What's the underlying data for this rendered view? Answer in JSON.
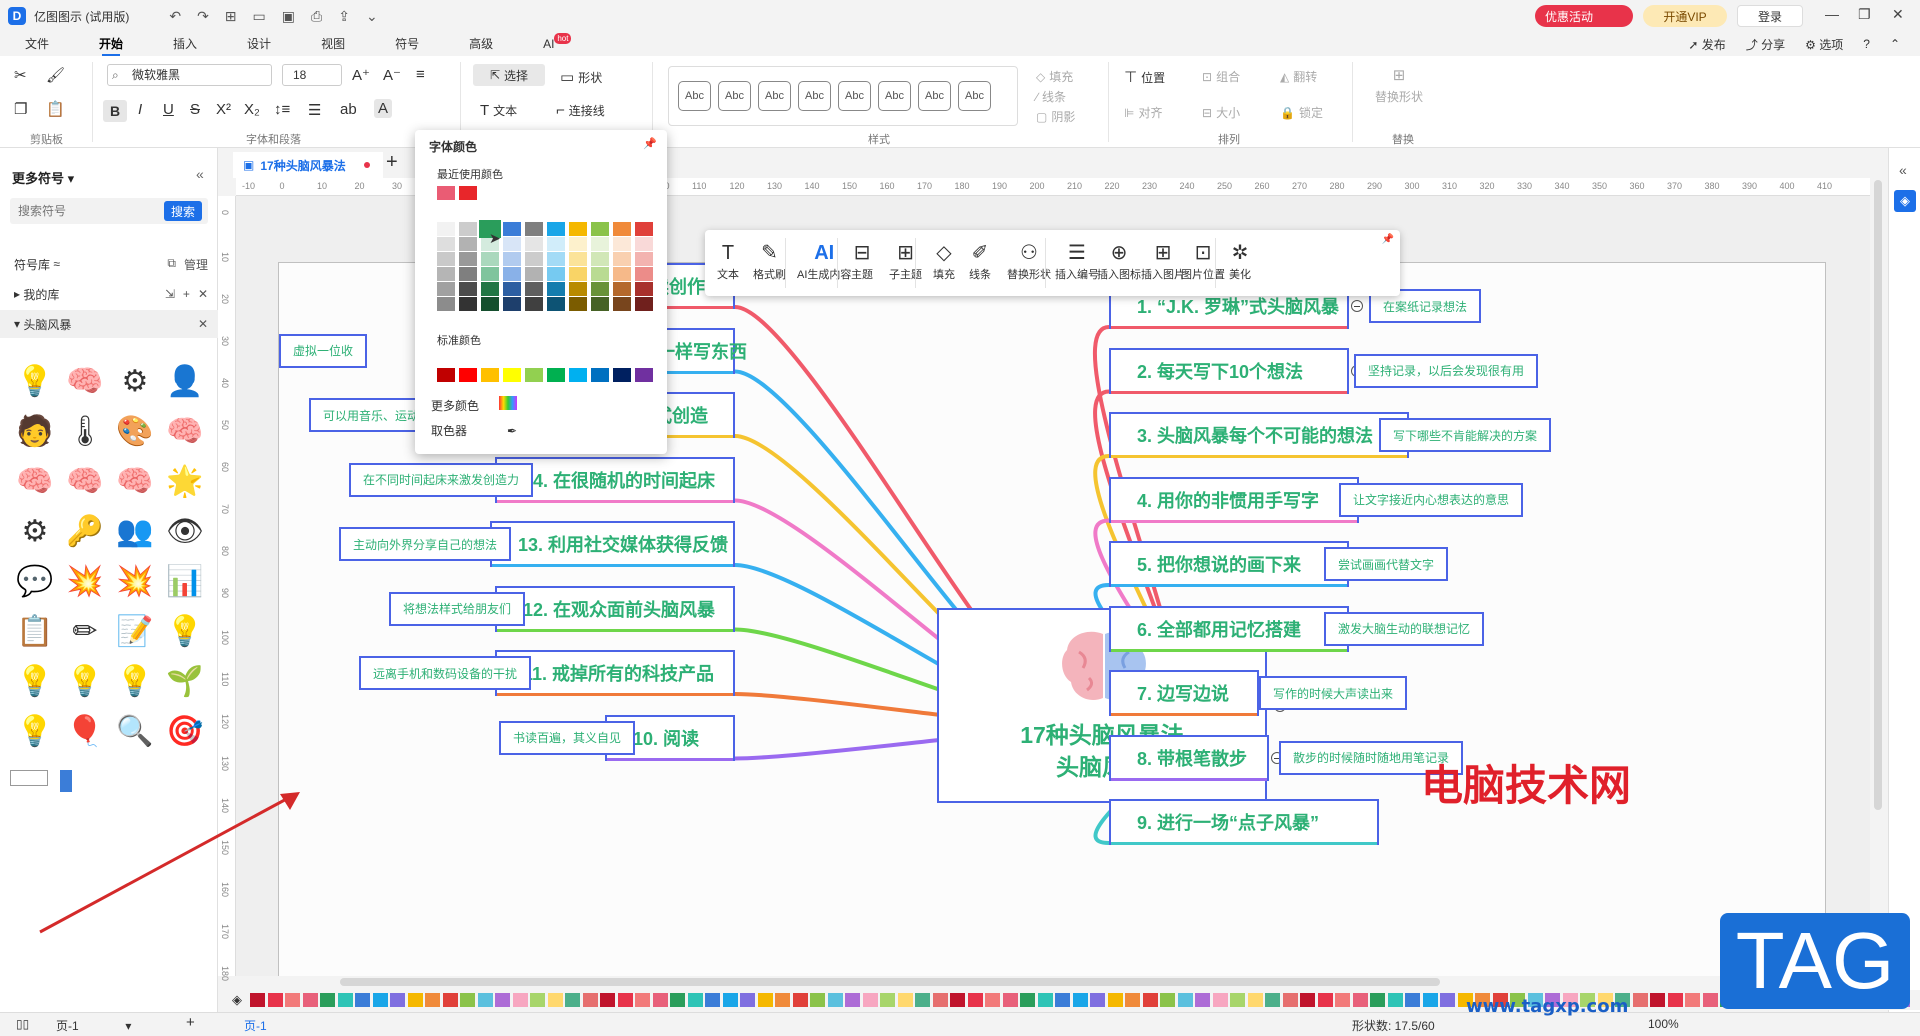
{
  "titlebar": {
    "app_title": "亿图图示 (试用版)",
    "promo": "优惠活动",
    "vip": "开通VIP",
    "login": "登录"
  },
  "menu": {
    "tabs": [
      "文件",
      "开始",
      "插入",
      "设计",
      "视图",
      "符号",
      "高级",
      "AI"
    ],
    "ai_badge": "hot",
    "right": [
      "发布",
      "分享",
      "选项"
    ]
  },
  "ribbon": {
    "font_family": "微软雅黑",
    "font_size": "18",
    "select_label": "选择",
    "shape_label": "形状",
    "text_label": "文本",
    "connector_label": "连接线",
    "fill_label": "填充",
    "line_label": "线条",
    "shadow_label": "阴影",
    "position_label": "位置",
    "group_label": "组合",
    "flip_label": "翻转",
    "align_label": "对齐",
    "size_label": "大小",
    "lock_label": "锁定",
    "replace_shape_label": "替换形状",
    "style_sample": "Abc",
    "groups": [
      "剪贴板",
      "字体和段落",
      "样式",
      "排列",
      "替换"
    ]
  },
  "left_panel": {
    "title": "更多符号",
    "search_placeholder": "搜索符号",
    "search_button": "搜索",
    "library_label": "符号库",
    "manage_label": "管理",
    "my_library": "我的库",
    "brainstorm_library": "头脑风暴",
    "symbols": [
      "💡",
      "🧠",
      "⚙",
      "👤",
      "🧑",
      "🌡",
      "🎨",
      "🧠",
      "🧠",
      "🧠",
      "🧠",
      "🌟",
      "⚙",
      "🔑",
      "👥",
      "👁",
      "💬",
      "💥",
      "💥",
      "📊",
      "📋",
      "✏",
      "📝",
      "💡",
      "💡",
      "💡",
      "💡",
      "🌱",
      "💡",
      "🎈",
      "🔍",
      "🎯"
    ]
  },
  "document": {
    "tab_title": "17种头脑风暴法"
  },
  "ruler": {
    "h_ticks": [
      "-10",
      "0",
      "10",
      "20",
      "30",
      "40",
      "50",
      "60",
      "70",
      "80",
      "90",
      "100",
      "110",
      "120",
      "130",
      "140",
      "150",
      "160",
      "170",
      "180",
      "190",
      "200",
      "210",
      "220",
      "230",
      "240",
      "250",
      "260",
      "270",
      "280",
      "290",
      "300",
      "310",
      "320",
      "330",
      "340",
      "350",
      "360",
      "370",
      "380",
      "390",
      "400",
      "410"
    ],
    "v_ticks": [
      "0",
      "10",
      "20",
      "30",
      "40",
      "50",
      "60",
      "70",
      "80",
      "90",
      "100",
      "110",
      "120",
      "130",
      "140",
      "150",
      "160",
      "170",
      "180"
    ]
  },
  "mindmap": {
    "center_line1": "17种头脑风暴法",
    "center_line2": "头脑风暴",
    "right_nodes": [
      {
        "label": "1.  “J.K. 罗琳”式头脑风暴",
        "note": "在案纸记录想法",
        "color": "#f05a6a"
      },
      {
        "label": "2. 每天写下10个想法",
        "note": "坚持记录，以后会发现很有用",
        "color": "#f05a6a"
      },
      {
        "label": "3. 头脑风暴每个不可能的想法",
        "note": "写下哪些不肯能解决的方案",
        "color": "#f5c430"
      },
      {
        "label": "4. 用你的非惯用手写字",
        "note": "让文字接近内心想表达的意思",
        "color": "#f07ac8"
      },
      {
        "label": "5. 把你想说的画下来",
        "note": "尝试画画代替文字",
        "color": "#36b0f0"
      },
      {
        "label": "6. 全部都用记忆搭建",
        "note": "激发大脑生动的联想记忆",
        "color": "#6ed64a"
      },
      {
        "label": "7. 边写边说",
        "note": "写作的时候大声读出来",
        "color": "#f07a3a"
      },
      {
        "label": "8. 带根笔散步",
        "note": "散步的时候随时随地用笔记录",
        "color": "#9a6af0"
      },
      {
        "label": "9. 进行一场“点子风暴”",
        "note": "",
        "color": "#40c8c8"
      }
    ],
    "left_nodes": [
      {
        "label": "17. 持续创作!",
        "note": "",
        "color": "#f05a6a"
      },
      {
        "label": "16. 像写信一样写东西",
        "note": "虚拟一位收",
        "color": "#36b0f0"
      },
      {
        "label": "15. 用完全不同的方式创造",
        "note": "可以用音乐、运动等方式激发灵感",
        "color": "#f5c430"
      },
      {
        "label": "14. 在很随机的时间起床",
        "note": "在不同时间起床来激发创造力",
        "color": "#f07ac8"
      },
      {
        "label": "13. 利用社交媒体获得反馈",
        "note": "主动向外界分享自己的想法",
        "color": "#36b0f0"
      },
      {
        "label": "12. 在观众面前头脑风暴",
        "note": "将想法样式给朋友们",
        "color": "#6ed64a"
      },
      {
        "label": "11. 戒掉所有的科技产品",
        "note": "远离手机和数码设备的干扰",
        "color": "#f07a3a"
      },
      {
        "label": "10. 阅读",
        "note": "书读百遍，其义自见",
        "color": "#9a6af0"
      }
    ]
  },
  "float_toolbar": {
    "items": [
      "文本",
      "格式刷",
      "AI生成内容",
      "主题",
      "子主题",
      "填充",
      "线条",
      "替换形状",
      "插入编号",
      "插入图标",
      "插入图片",
      "图片位置",
      "美化"
    ],
    "ai_text": "AI"
  },
  "color_popup": {
    "title": "字体颜色",
    "recent_label": "最近使用颜色",
    "recent_colors": [
      "#ea5c74",
      "#e8262a"
    ],
    "standard_label": "标准颜色",
    "standard_colors": [
      "#c00000",
      "#ff0000",
      "#ffc000",
      "#ffff00",
      "#92d050",
      "#00b050",
      "#00b0f0",
      "#0070c0",
      "#002060",
      "#7030a0"
    ],
    "more_colors": "更多颜色",
    "picker": "取色器",
    "theme_top": [
      "#ffffff",
      "#000000",
      "#2a9d5b",
      "#3b7dd8",
      "#7f7f7f",
      "#1aa6e8",
      "#f5b800",
      "#8bc34a",
      "#f08a3a",
      "#e0403a"
    ]
  },
  "statusbar": {
    "page_label": "页-1",
    "page_tab": "页-1",
    "shape_count": "形状数: 17.5/60",
    "zoom": "100%"
  },
  "watermark": {
    "cn": "电脑技术网",
    "tag": "TAG",
    "url": "www.tagxp.com"
  }
}
